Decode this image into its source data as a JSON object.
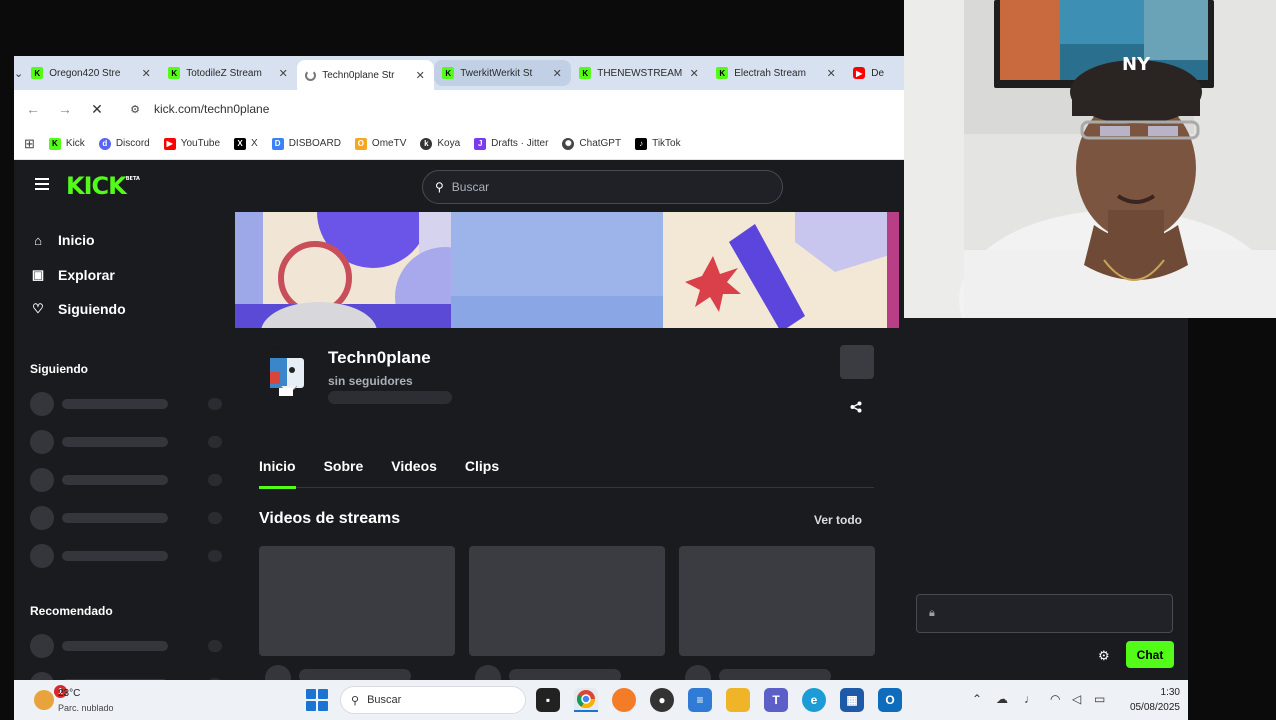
{
  "browser": {
    "tabs": [
      {
        "title": "Oregon420 Stre",
        "favicon": "kick-icon"
      },
      {
        "title": "TotodileZ Stream",
        "favicon": "kick-icon"
      },
      {
        "title": "Techn0plane Str",
        "favicon": "loading-spinner-icon",
        "active": true
      },
      {
        "title": "TwerkitWerkit St",
        "favicon": "kick-icon",
        "hovered": true
      },
      {
        "title": "THENEWSTREAM",
        "favicon": "kick-icon"
      },
      {
        "title": "Electrah Stream",
        "favicon": "kick-icon"
      },
      {
        "title": "De",
        "favicon": "youtube-icon"
      }
    ],
    "url": "kick.com/techn0plane",
    "bookmarks": [
      {
        "label": "Kick",
        "icon": "kick-icon",
        "color": "#53fc18"
      },
      {
        "label": "Discord",
        "icon": "discord-icon",
        "color": "#5865f2"
      },
      {
        "label": "YouTube",
        "icon": "youtube-icon",
        "color": "#ff0000"
      },
      {
        "label": "X",
        "icon": "x-icon",
        "color": "#000000"
      },
      {
        "label": "DISBOARD",
        "icon": "disboard-icon",
        "color": "#3b82f6"
      },
      {
        "label": "OmeTV",
        "icon": "ometv-icon",
        "color": "#f5a623"
      },
      {
        "label": "Koya",
        "icon": "koya-icon",
        "color": "#333333"
      },
      {
        "label": "Drafts · Jitter",
        "icon": "jitter-icon",
        "color": "#7c3aed"
      },
      {
        "label": "ChatGPT",
        "icon": "chatgpt-icon",
        "color": "#444444"
      },
      {
        "label": "TikTok",
        "icon": "tiktok-icon",
        "color": "#000000"
      }
    ]
  },
  "kick": {
    "brand_color": "#53fc18",
    "logo": "KICK",
    "logo_tag": "BETA",
    "search_placeholder": "Buscar",
    "nav": [
      {
        "label": "Inicio",
        "icon": "home-icon"
      },
      {
        "label": "Explorar",
        "icon": "compass-icon"
      },
      {
        "label": "Siguiendo",
        "icon": "heart-icon"
      }
    ],
    "section_following": "Siguiendo",
    "section_recommended": "Recomendado",
    "channel": {
      "name": "Techn0plane",
      "followers": "sin seguidores"
    },
    "tabs": [
      "Inicio",
      "Sobre",
      "Videos",
      "Clips"
    ],
    "active_tab": "Inicio",
    "videos_title": "Videos de streams",
    "see_all": "Ver todo",
    "chat_button": "Chat"
  },
  "taskbar": {
    "temperature": "23°C",
    "condition": "Parc. nublado",
    "notification_count": "1",
    "search_placeholder": "Buscar",
    "time": "1:30",
    "date": "05/08/2025",
    "apps": [
      "task-view-icon",
      "chrome-icon",
      "firefox-icon",
      "obs-icon",
      "notepad-icon",
      "file-explorer-icon",
      "teams-icon",
      "edge-icon",
      "store-icon",
      "outlook-icon"
    ]
  }
}
